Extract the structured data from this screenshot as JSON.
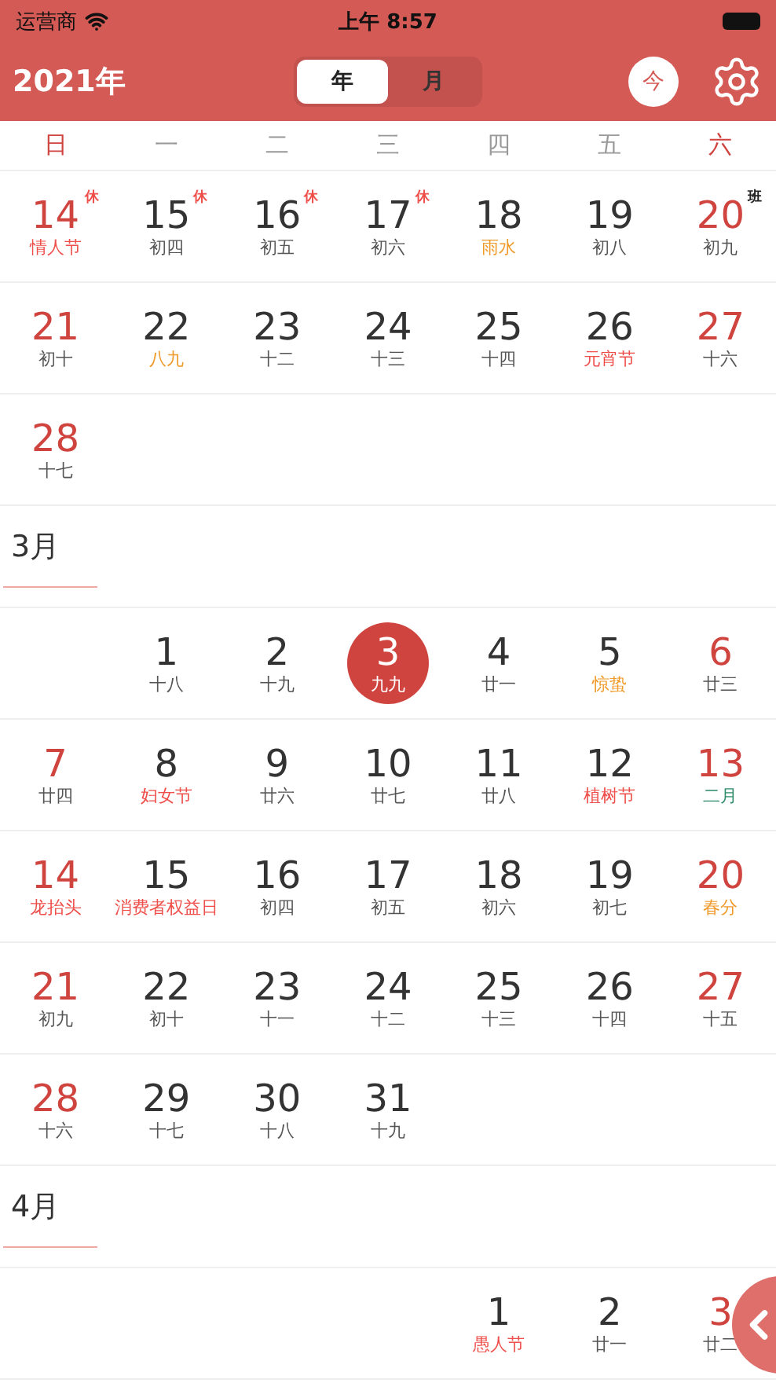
{
  "status_bar": {
    "carrier": "运营商",
    "time": "上午 8:57"
  },
  "header": {
    "year": "2021年",
    "segments": [
      {
        "label": "年",
        "selected": true
      },
      {
        "label": "月",
        "selected": false
      }
    ],
    "today_button": "今"
  },
  "weekdays": [
    {
      "label": "日",
      "weekend": true
    },
    {
      "label": "一",
      "weekend": false
    },
    {
      "label": "二",
      "weekend": false
    },
    {
      "label": "三",
      "weekend": false
    },
    {
      "label": "四",
      "weekend": false
    },
    {
      "label": "五",
      "weekend": false
    },
    {
      "label": "六",
      "weekend": true
    }
  ],
  "months": [
    {
      "weeks": [
        {
          "kind": "full",
          "days": [
            {
              "day": "14",
              "sub": "情人节",
              "kind": "festival",
              "selected": false,
              "badge": {
                "text": "休",
                "color": "#ef4f4a"
              }
            },
            {
              "day": "15",
              "sub": "初四",
              "kind": "lunar",
              "selected": false,
              "badge": {
                "text": "休",
                "color": "#ef4f4a"
              }
            },
            {
              "day": "16",
              "sub": "初五",
              "kind": "lunar",
              "selected": false,
              "badge": {
                "text": "休",
                "color": "#ef4f4a"
              }
            },
            {
              "day": "17",
              "sub": "初六",
              "kind": "lunar",
              "selected": false,
              "badge": {
                "text": "休",
                "color": "#ef4f4a"
              }
            },
            {
              "day": "18",
              "sub": "雨水",
              "kind": "term",
              "selected": false
            },
            {
              "day": "19",
              "sub": "初八",
              "kind": "lunar",
              "selected": false
            },
            {
              "day": "20",
              "sub": "初九",
              "kind": "lunar",
              "selected": false,
              "badge": {
                "text": "班",
                "color": "#222222"
              }
            }
          ]
        },
        {
          "kind": "full",
          "days": [
            {
              "day": "21",
              "sub": "初十",
              "kind": "lunar",
              "selected": false
            },
            {
              "day": "22",
              "sub": "八九",
              "kind": "term",
              "selected": false
            },
            {
              "day": "23",
              "sub": "十二",
              "kind": "lunar",
              "selected": false
            },
            {
              "day": "24",
              "sub": "十三",
              "kind": "lunar",
              "selected": false
            },
            {
              "day": "25",
              "sub": "十四",
              "kind": "lunar",
              "selected": false
            },
            {
              "day": "26",
              "sub": "元宵节",
              "kind": "festival",
              "selected": false
            },
            {
              "day": "27",
              "sub": "十六",
              "kind": "lunar",
              "selected": false
            }
          ]
        },
        {
          "kind": "last",
          "days": [
            {
              "day": "28",
              "sub": "十七",
              "kind": "lunar",
              "selected": false
            }
          ]
        }
      ]
    },
    {
      "title": "3月",
      "weeks": [
        {
          "kind": "first",
          "days": [
            {
              "day": "1",
              "sub": "十八",
              "kind": "lunar",
              "selected": false
            },
            {
              "day": "2",
              "sub": "十九",
              "kind": "lunar",
              "selected": false
            },
            {
              "day": "3",
              "sub": "九九",
              "selected": true
            },
            {
              "day": "4",
              "sub": "廿一",
              "kind": "lunar",
              "selected": false
            },
            {
              "day": "5",
              "sub": "惊蛰",
              "kind": "term",
              "selected": false
            },
            {
              "day": "6",
              "sub": "廿三",
              "kind": "lunar",
              "selected": false
            }
          ]
        },
        {
          "kind": "full",
          "days": [
            {
              "day": "7",
              "sub": "廿四",
              "kind": "lunar",
              "selected": false
            },
            {
              "day": "8",
              "sub": "妇女节",
              "kind": "festival",
              "selected": false
            },
            {
              "day": "9",
              "sub": "廿六",
              "kind": "lunar",
              "selected": false
            },
            {
              "day": "10",
              "sub": "廿七",
              "kind": "lunar",
              "selected": false
            },
            {
              "day": "11",
              "sub": "廿八",
              "kind": "lunar",
              "selected": false
            },
            {
              "day": "12",
              "sub": "植树节",
              "kind": "festival",
              "selected": false
            },
            {
              "day": "13",
              "sub": "二月",
              "kind": "month",
              "selected": false
            }
          ]
        },
        {
          "kind": "full",
          "days": [
            {
              "day": "14",
              "sub": "龙抬头",
              "kind": "festival",
              "selected": false
            },
            {
              "day": "15",
              "sub": "消费者权益日",
              "kind": "festival",
              "selected": false
            },
            {
              "day": "16",
              "sub": "初四",
              "kind": "lunar",
              "selected": false
            },
            {
              "day": "17",
              "sub": "初五",
              "kind": "lunar",
              "selected": false
            },
            {
              "day": "18",
              "sub": "初六",
              "kind": "lunar",
              "selected": false
            },
            {
              "day": "19",
              "sub": "初七",
              "kind": "lunar",
              "selected": false
            },
            {
              "day": "20",
              "sub": "春分",
              "kind": "term",
              "selected": false
            }
          ]
        },
        {
          "kind": "full",
          "days": [
            {
              "day": "21",
              "sub": "初九",
              "kind": "lunar",
              "selected": false
            },
            {
              "day": "22",
              "sub": "初十",
              "kind": "lunar",
              "selected": false
            },
            {
              "day": "23",
              "sub": "十一",
              "kind": "lunar",
              "selected": false
            },
            {
              "day": "24",
              "sub": "十二",
              "kind": "lunar",
              "selected": false
            },
            {
              "day": "25",
              "sub": "十三",
              "kind": "lunar",
              "selected": false
            },
            {
              "day": "26",
              "sub": "十四",
              "kind": "lunar",
              "selected": false
            },
            {
              "day": "27",
              "sub": "十五",
              "kind": "lunar",
              "selected": false
            }
          ]
        },
        {
          "kind": "last",
          "days": [
            {
              "day": "28",
              "sub": "十六",
              "kind": "lunar",
              "selected": false
            },
            {
              "day": "29",
              "sub": "十七",
              "kind": "lunar",
              "selected": false
            },
            {
              "day": "30",
              "sub": "十八",
              "kind": "lunar",
              "selected": false
            },
            {
              "day": "31",
              "sub": "十九",
              "kind": "lunar",
              "selected": false
            }
          ]
        }
      ]
    },
    {
      "title": "4月",
      "weeks": [
        {
          "kind": "first",
          "days": [
            {
              "day": "1",
              "sub": "愚人节",
              "kind": "festival",
              "selected": false
            },
            {
              "day": "2",
              "sub": "廿一",
              "kind": "lunar",
              "selected": false
            },
            {
              "day": "3",
              "sub": "廿二",
              "kind": "lunar",
              "selected": false
            }
          ]
        }
      ]
    }
  ]
}
